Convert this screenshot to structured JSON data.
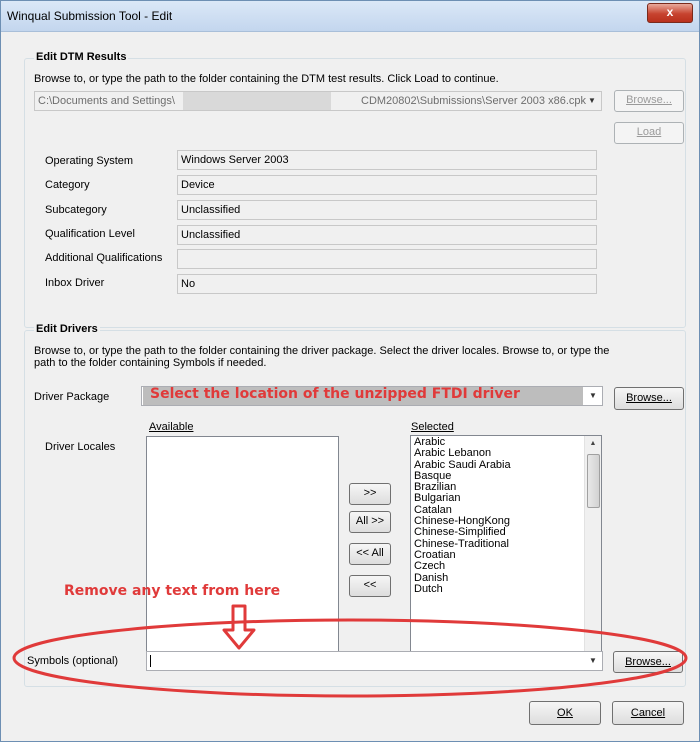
{
  "window": {
    "title": "Winqual Submission Tool - Edit",
    "close_glyph": "x"
  },
  "dtm": {
    "title": "Edit DTM Results",
    "description": "Browse to, or type the path to the folder containing the DTM test results. Click Load to continue.",
    "path_left": "C:\\Documents and Settings\\",
    "path_right": "CDM20802\\Submissions\\Server 2003 x86.cpk",
    "browse_label": "Browse...",
    "load_label": "Load",
    "fields": [
      {
        "label": "Operating System",
        "value": "Windows Server 2003"
      },
      {
        "label": "Category",
        "value": "Device"
      },
      {
        "label": "Subcategory",
        "value": "Unclassified"
      },
      {
        "label": "Qualification Level",
        "value": "Unclassified"
      },
      {
        "label": "Additional Qualifications",
        "value": ""
      },
      {
        "label": "Inbox Driver",
        "value": "No"
      }
    ]
  },
  "drivers": {
    "title": "Edit Drivers",
    "description_line1": "Browse to, or type the path to the folder containing the driver package. Select the driver locales. Browse to, or type the",
    "description_line2": "path to the folder containing Symbols if needed.",
    "package_label": "Driver Package",
    "package_value": "Select the location of the unzipped FTDI driver",
    "browse_label": "Browse...",
    "locales_label": "Driver Locales",
    "available_label": "Available",
    "selected_label": "Selected",
    "available_items": [],
    "selected_items": [
      "Arabic",
      "Arabic Lebanon",
      "Arabic Saudi Arabia",
      "Basque",
      "Brazilian",
      "Bulgarian",
      "Catalan",
      "Chinese-HongKong",
      "Chinese-Simplified",
      "Chinese-Traditional",
      "Croatian",
      "Czech",
      "Danish",
      "Dutch"
    ],
    "move_buttons": [
      ">>",
      "All >>",
      "<< All",
      "<<"
    ],
    "symbols_label": "Symbols (optional)",
    "symbols_value": "",
    "symbols_browse_label": "Browse..."
  },
  "annotations": {
    "remove_text": "Remove any text from here",
    "colors": {
      "annotation": "#e03a3a",
      "arrow": "#e03a3a"
    }
  },
  "footer": {
    "ok_label": "OK",
    "cancel_label": "Cancel"
  }
}
